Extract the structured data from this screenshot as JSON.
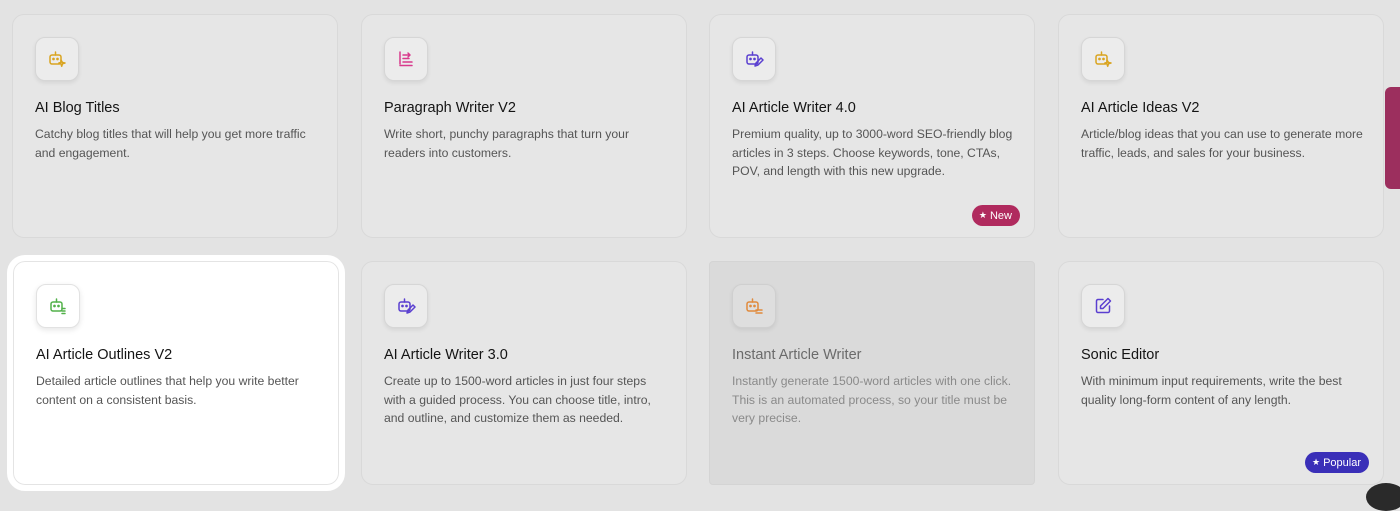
{
  "cards": [
    {
      "title": "AI Blog Titles",
      "description": "Catchy blog titles that will help you get more traffic and engagement.",
      "icon": "robot-sparkle-icon",
      "icon_color": "#d9a420"
    },
    {
      "title": "Paragraph Writer V2",
      "description": "Write short, punchy paragraphs that turn your readers into customers.",
      "icon": "paragraph-indent-icon",
      "icon_color": "#d83a8c"
    },
    {
      "title": "AI Article Writer 4.0",
      "description": "Premium quality, up to 3000-word SEO-friendly blog articles in 3 steps. Choose keywords, tone, CTAs, POV, and length with this new upgrade.",
      "icon": "robot-pen-icon",
      "icon_color": "#5a3fd0",
      "badge": {
        "label": "New",
        "color": "#b02a5e"
      }
    },
    {
      "title": "AI Article Ideas V2",
      "description": "Article/blog ideas that you can use to generate more traffic, leads, and sales for your business.",
      "icon": "robot-sparkle-icon",
      "icon_color": "#d9a420"
    },
    {
      "title": "AI Article Outlines V2",
      "description": "Detailed article outlines that help you write better content on a consistent basis.",
      "icon": "robot-outline-icon",
      "icon_color": "#52b14a"
    },
    {
      "title": "AI Article Writer 3.0",
      "description": "Create up to 1500-word articles in just four steps with a guided process. You can choose title, intro, and outline, and customize them as needed.",
      "icon": "robot-pen-icon",
      "icon_color": "#5a3fd0"
    },
    {
      "title": "Instant Article Writer",
      "description": "Instantly generate 1500-word articles with one click. This is an automated process, so your title must be very precise.",
      "icon": "robot-lines-icon",
      "icon_color": "#e08a3c"
    },
    {
      "title": "Sonic Editor",
      "description": "With minimum input requirements, write the best quality long-form content of any length.",
      "icon": "edit-square-icon",
      "icon_color": "#5a3fd0",
      "badge": {
        "label": "Popular",
        "color": "#3a2fb8"
      }
    }
  ]
}
